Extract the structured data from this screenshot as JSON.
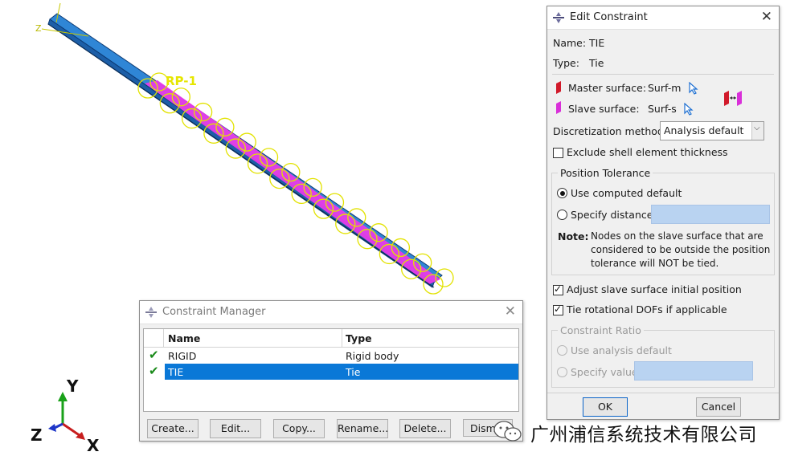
{
  "viewport": {
    "rp_label": "RP-1",
    "beam_axis_label": "Z",
    "triad": {
      "y": "Y",
      "z": "Z",
      "x": "X"
    }
  },
  "edit_constraint": {
    "title": "Edit Constraint",
    "name_label": "Name:",
    "name_value": "TIE",
    "type_label": "Type:",
    "type_value": "Tie",
    "master_label": "Master surface:",
    "master_value": "Surf-m",
    "slave_label": "Slave surface:",
    "slave_value": "Surf-s",
    "discretization_label": "Discretization method:",
    "discretization_value": "Analysis default",
    "exclude_shell_label": "Exclude shell element thickness",
    "exclude_shell_checked": false,
    "position_tolerance_title": "Position Tolerance",
    "use_computed_default_label": "Use computed default",
    "specify_distance_label": "Specify distance:",
    "note_label": "Note:",
    "note_lines": [
      "Nodes on the slave surface that are",
      "considered to be outside the position",
      "tolerance will NOT be tied."
    ],
    "adjust_slave_label": "Adjust slave surface initial position",
    "adjust_slave_checked": true,
    "tie_rotational_label": "Tie rotational DOFs if applicable",
    "tie_rotational_checked": true,
    "constraint_ratio_title": "Constraint Ratio",
    "use_analysis_default_label": "Use analysis default",
    "specify_value_label": "Specify value",
    "ok_label": "OK",
    "cancel_label": "Cancel"
  },
  "constraint_manager": {
    "title": "Constraint Manager",
    "columns": [
      "Name",
      "Type"
    ],
    "rows": [
      {
        "name": "RIGID",
        "type": "Rigid body",
        "active": true,
        "selected": false
      },
      {
        "name": "TIE",
        "type": "Tie",
        "active": true,
        "selected": true
      }
    ],
    "buttons": [
      "Create...",
      "Edit...",
      "Copy...",
      "Rename...",
      "Delete...",
      "Dism"
    ]
  },
  "watermark": {
    "text": "广州浦信系统技术有限公司"
  },
  "colors": {
    "beam_blue": "#2f86d6",
    "slave_magenta": "#e83be8",
    "constraint_yellow": "#e8e800",
    "selection_blue": "#0a78d7"
  }
}
